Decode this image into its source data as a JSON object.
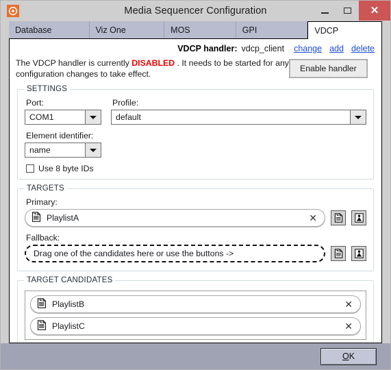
{
  "window": {
    "title": "Media Sequencer Configuration",
    "app_icon": "viz-compass-icon",
    "controls": {
      "minimize": "minimize-icon",
      "maximize": "maximize-icon",
      "close": "close-icon",
      "close_glyph": "✕"
    },
    "accent_color": "#e8702a",
    "close_color": "#cc5555"
  },
  "tabs": [
    {
      "label": "Database",
      "active": false
    },
    {
      "label": "Viz One",
      "active": false
    },
    {
      "label": "MOS",
      "active": false
    },
    {
      "label": "GPI",
      "active": false
    },
    {
      "label": "VDCP",
      "active": true
    }
  ],
  "handler": {
    "label": "VDCP handler:",
    "value": "vdcp_client",
    "links": [
      {
        "label": "change"
      },
      {
        "label": "add"
      },
      {
        "label": "delete"
      }
    ],
    "link_color": "#1c4ed8"
  },
  "status": {
    "prefix": "The VDCP handler is currently",
    "state": "DISABLED",
    "state_color": "#ee0000",
    "suffix": ". It needs to be started for any configuration  changes to take effect.",
    "button_label": "Enable handler"
  },
  "settings": {
    "legend": "SETTINGS",
    "port": {
      "label": "Port:",
      "value": "COM1"
    },
    "profile": {
      "label": "Profile:",
      "value": "default"
    },
    "element_identifier": {
      "label": "Element identifier:",
      "value": "name"
    },
    "use_8_byte_ids": {
      "label": "Use 8 byte IDs",
      "checked": false
    }
  },
  "targets": {
    "legend": "TARGETS",
    "primary": {
      "label": "Primary:",
      "value": "PlaylistA",
      "icon": "playlist-document-icon",
      "clear_glyph": "✕",
      "empty": false
    },
    "fallback": {
      "label": "Fallback:",
      "value": "Drag one of the candidates here or use the buttons ->",
      "empty": true
    },
    "action_buttons": [
      {
        "name": "add-playlist-icon"
      },
      {
        "name": "add-scene-icon"
      }
    ]
  },
  "candidates": {
    "legend": "TARGET CANDIDATES",
    "items": [
      {
        "label": "PlaylistB",
        "icon": "playlist-document-icon",
        "clear_glyph": "✕"
      },
      {
        "label": "PlaylistC",
        "icon": "playlist-document-icon",
        "clear_glyph": "✕"
      }
    ]
  },
  "footer": {
    "ok_accel": "O",
    "ok_rest": "K"
  }
}
